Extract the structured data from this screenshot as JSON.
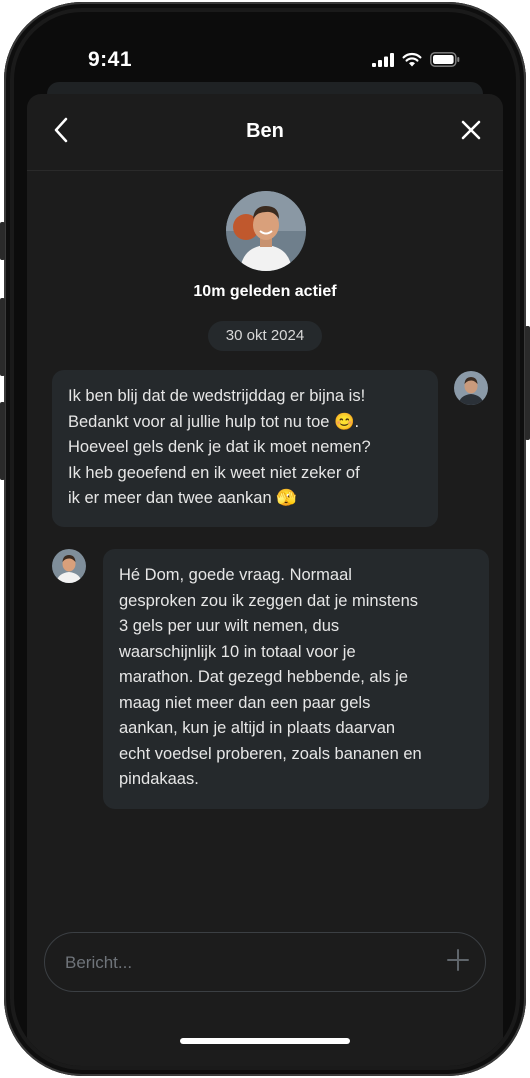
{
  "status_bar": {
    "time": "9:41"
  },
  "header": {
    "title": "Ben"
  },
  "profile": {
    "active_status": "10m geleden actief"
  },
  "conversation": {
    "date": "30 okt 2024",
    "messages": [
      {
        "sender": "me",
        "text": "Ik ben blij dat de wedstrijddag er bijna is!\nBedankt voor al jullie hulp tot nu toe 😊.\nHoeveel gels denk je dat ik moet nemen?\nIk heb geoefend en ik weet niet zeker of\nik er meer dan twee aankan 🫣"
      },
      {
        "sender": "Ben",
        "text": "Hé Dom, goede vraag. Normaal\ngesproken zou ik zeggen dat je minstens\n3 gels per uur wilt nemen, dus\nwaarschijnlijk 10 in totaal voor je\nmarathon. Dat gezegd hebbende, als je\nmaag niet meer dan een paar gels\naankan, kun je altijd in plaats daarvan\necht voedsel proberen, zoals bananen en\npindakaas."
      }
    ]
  },
  "composer": {
    "placeholder": "Bericht..."
  },
  "icons": {
    "back": "chevron-left-icon",
    "close": "close-icon",
    "add": "plus-icon",
    "signal": "signal-icon",
    "wifi": "wifi-icon",
    "battery": "battery-icon"
  },
  "colors": {
    "screen_bg": "#0c0c0c",
    "sheet_bg": "#1c1c1c",
    "bubble_bg": "#25292c",
    "text": "#ffffff"
  }
}
